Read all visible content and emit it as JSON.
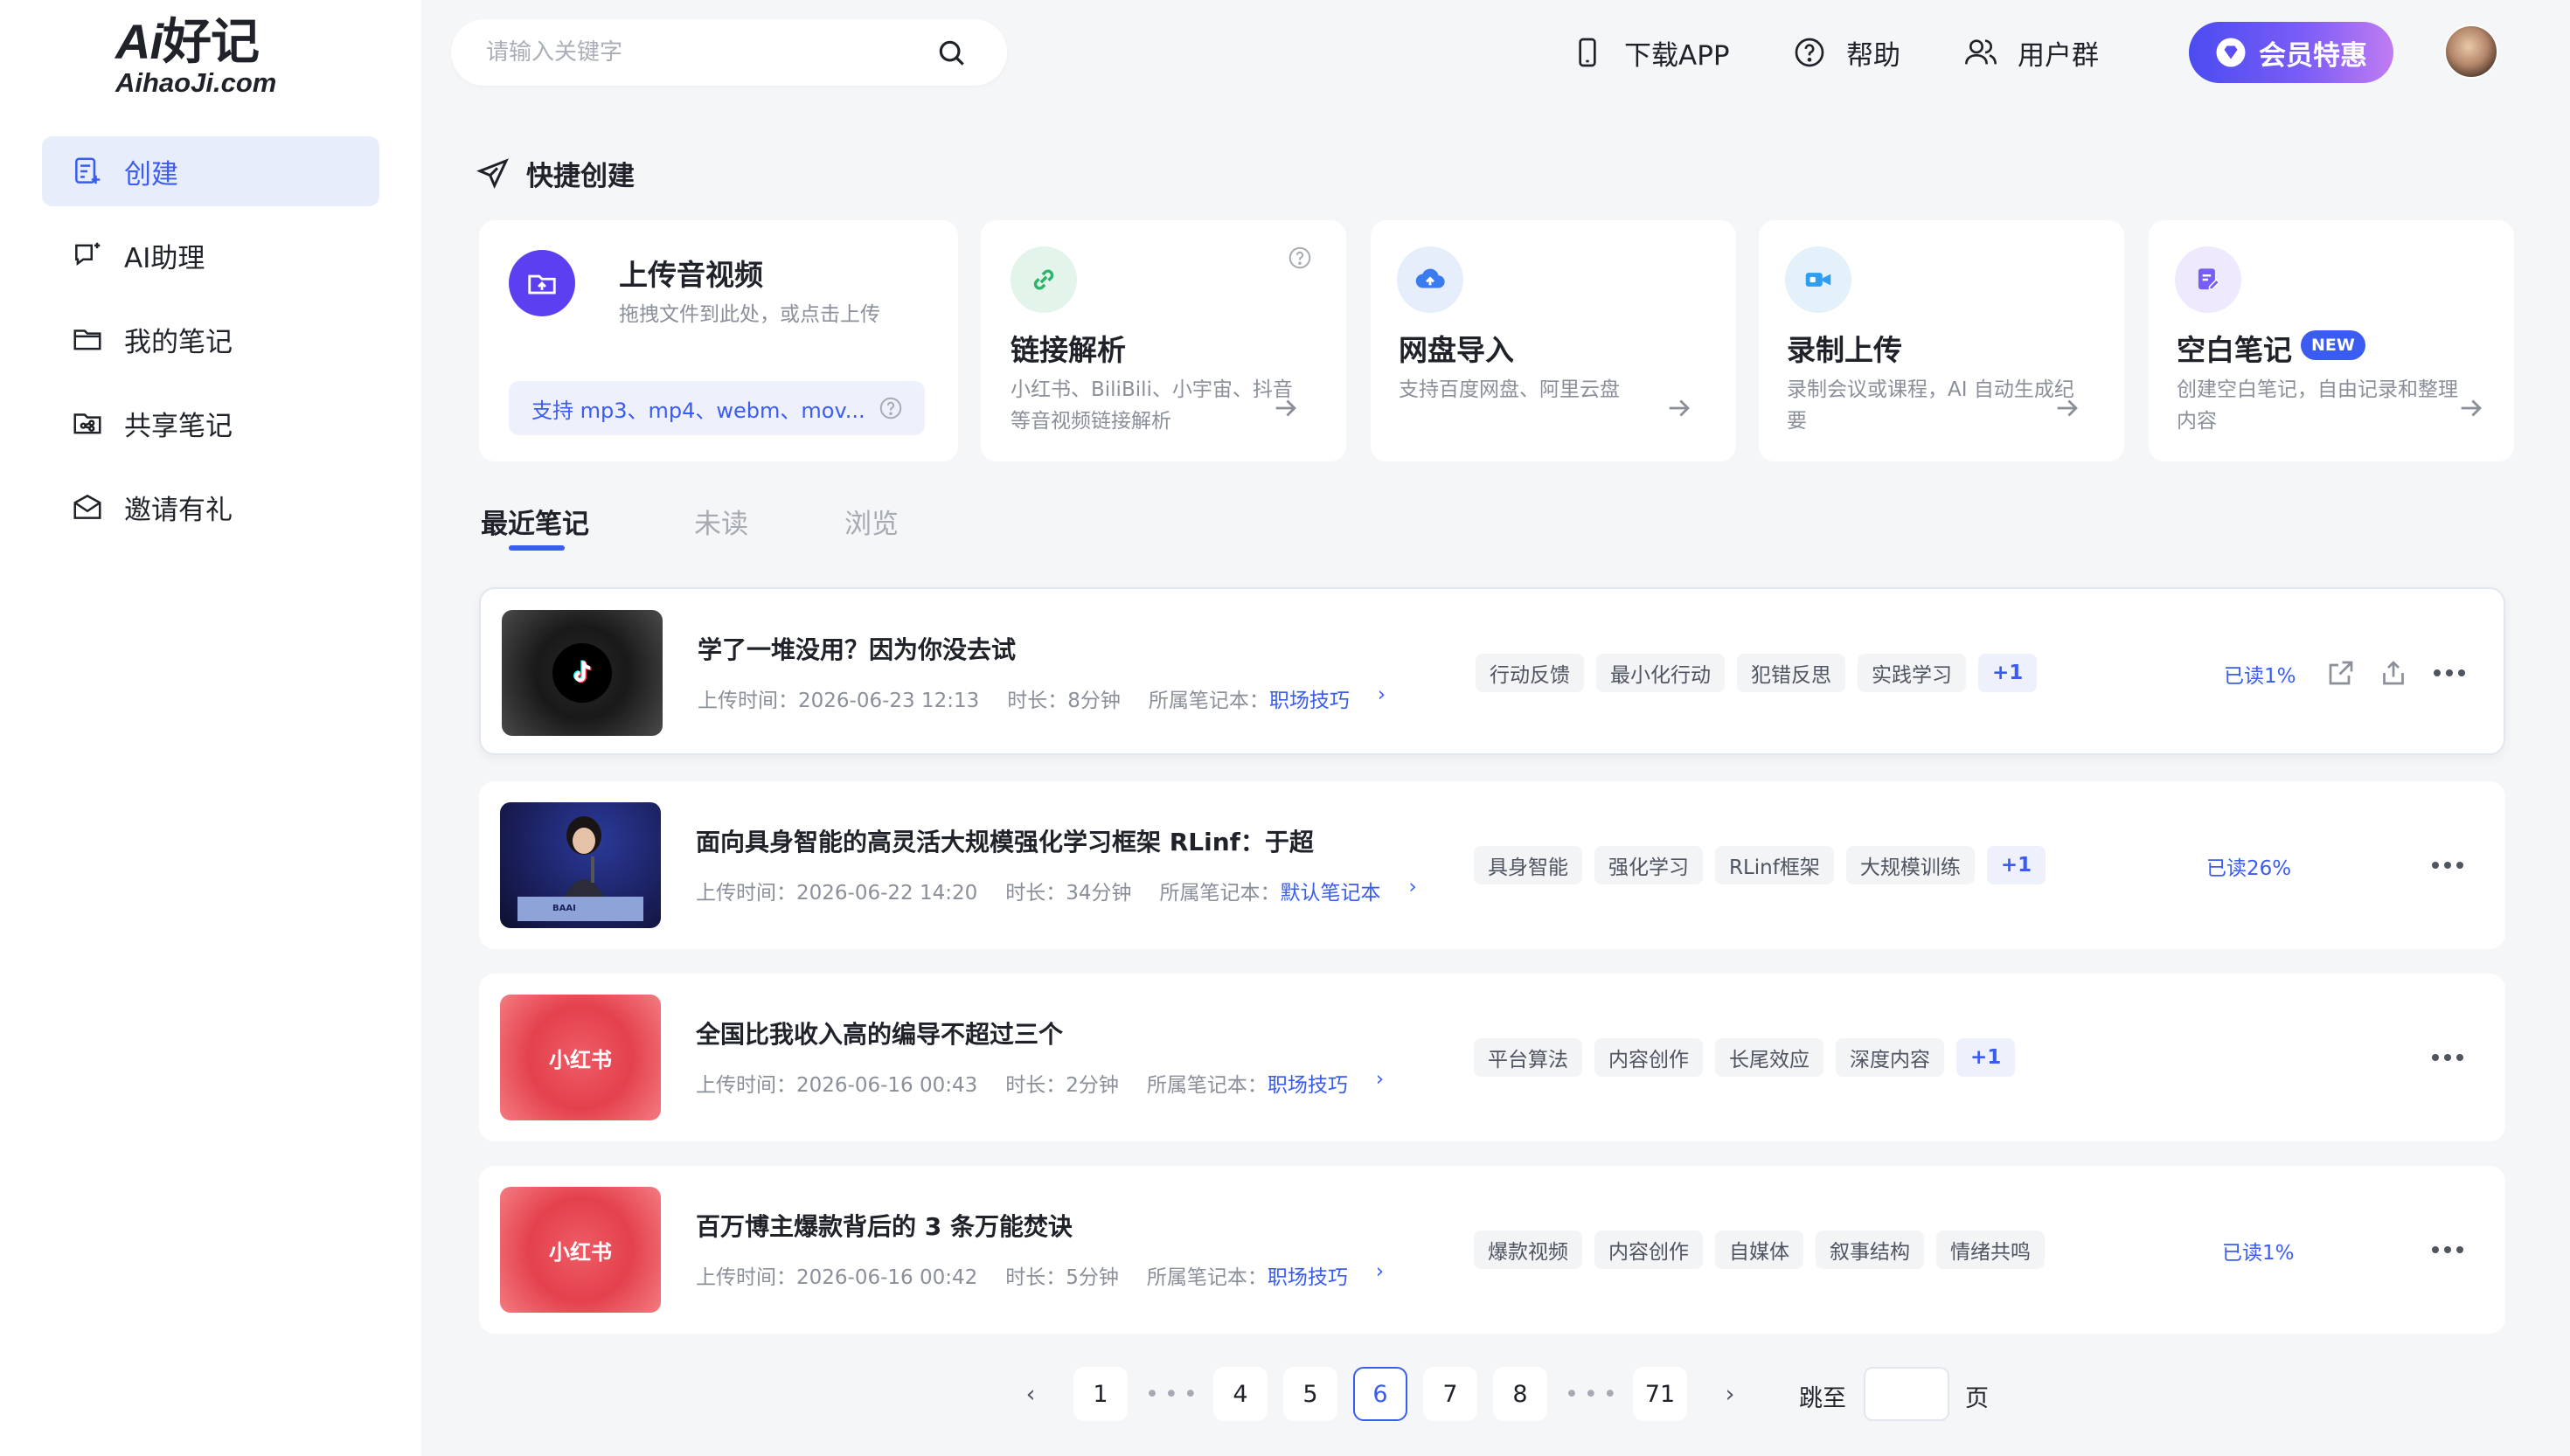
{
  "brand": {
    "logo_line1_ai": "Ai",
    "logo_line1_rest": "好记",
    "logo_line2": "AihaoJi.com"
  },
  "colors": {
    "accent": "#3a5cf0",
    "vip_start": "#4b4cf2",
    "vip_end": "#c07cf2",
    "xhs_red": "#e4414c"
  },
  "sidebar": {
    "items": [
      {
        "label": "创建",
        "icon": "create-note-icon",
        "active": true
      },
      {
        "label": "AI助理",
        "icon": "ai-chat-icon",
        "active": false
      },
      {
        "label": "我的笔记",
        "icon": "folder-icon",
        "active": false
      },
      {
        "label": "共享笔记",
        "icon": "shared-folder-icon",
        "active": false
      },
      {
        "label": "邀请有礼",
        "icon": "gift-mail-icon",
        "active": false
      }
    ]
  },
  "header": {
    "search_placeholder": "请输入关键字",
    "download_app": "下载APP",
    "help": "帮助",
    "user_group": "用户群",
    "vip": "会员特惠"
  },
  "quick_create": {
    "title": "快捷创建",
    "upload": {
      "title": "上传音视频",
      "desc": "拖拽文件到此处，或点击上传",
      "formats": "支持 mp3、mp4、webm、mov..."
    },
    "link": {
      "title": "链接解析",
      "desc_line1": "小红书、BiliBili、小宇宙、抖音",
      "desc_line2": "等音视频链接解析"
    },
    "cloud": {
      "title": "网盘导入",
      "desc_line1": "支持百度网盘、阿里云盘"
    },
    "record": {
      "title": "录制上传",
      "desc_line1": "录制会议或课程，AI 自动生成纪",
      "desc_line2": "要"
    },
    "blank": {
      "title": "空白笔记",
      "badge": "NEW",
      "desc_line1": "创建空白笔记，自由记录和整理",
      "desc_line2": "内容"
    }
  },
  "tabs": {
    "recent": "最近笔记",
    "unread": "未读",
    "browse": "浏览"
  },
  "notes": [
    {
      "title": "学了一堆没用？因为你没去试",
      "upload_time": "上传时间：2026-06-23 12:13",
      "duration": "时长：8分钟",
      "notebook_label": "所属笔记本：",
      "notebook": "职场技巧",
      "tags": [
        "行动反馈",
        "最小化行动",
        "犯错反思",
        "实践学习"
      ],
      "more_tags": "+1",
      "read": "已读1%",
      "thumb": "tiktok"
    },
    {
      "title": "面向具身智能的高灵活大规模强化学习框架 RLinf：于超",
      "upload_time": "上传时间：2026-06-22 14:20",
      "duration": "时长：34分钟",
      "notebook_label": "所属笔记本：",
      "notebook": "默认笔记本",
      "tags": [
        "具身智能",
        "强化学习",
        "RLinf框架",
        "大规模训练"
      ],
      "more_tags": "+1",
      "read": "已读26%",
      "thumb": "baai",
      "thumb_text": "BAAI"
    },
    {
      "title": "全国比我收入高的编导不超过三个",
      "upload_time": "上传时间：2026-06-16 00:43",
      "duration": "时长：2分钟",
      "notebook_label": "所属笔记本：",
      "notebook": "职场技巧",
      "tags": [
        "平台算法",
        "内容创作",
        "长尾效应",
        "深度内容"
      ],
      "more_tags": "+1",
      "read": "",
      "thumb": "xhs",
      "thumb_text": "小红书"
    },
    {
      "title": "百万博主爆款背后的 3 条万能焚诀",
      "upload_time": "上传时间：2026-06-16 00:42",
      "duration": "时长：5分钟",
      "notebook_label": "所属笔记本：",
      "notebook": "职场技巧",
      "tags": [
        "爆款视频",
        "内容创作",
        "自媒体",
        "叙事结构",
        "情绪共鸣"
      ],
      "more_tags": "",
      "read": "已读1%",
      "thumb": "xhs",
      "thumb_text": "小红书"
    }
  ],
  "pagination": {
    "pages": [
      "1",
      "4",
      "5",
      "6",
      "7",
      "8",
      "71"
    ],
    "current": "6",
    "ellipsis": "•••",
    "jump_label": "跳至",
    "page_suffix": "页"
  }
}
